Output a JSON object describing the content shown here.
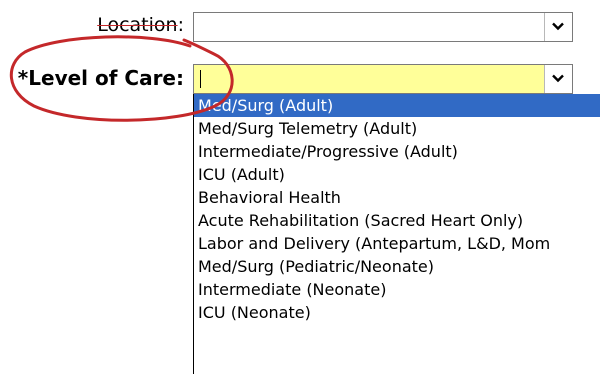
{
  "form": {
    "location_label": "Location",
    "location_colon": ":",
    "location_value": "",
    "level_label": "*Level of Care:",
    "level_value": ""
  },
  "dropdown": {
    "options": [
      "Med/Surg (Adult)",
      "Med/Surg Telemetry (Adult)",
      "Intermediate/Progressive  (Adult)",
      "ICU (Adult)",
      "Behavioral Health",
      "Acute Rehabilitation (Sacred Heart Only)",
      "Labor and Delivery (Antepartum, L&D, Mom",
      "Med/Surg (Pediatric/Neonate)",
      "Intermediate (Neonate)",
      "ICU (Neonate)"
    ],
    "selected_index": 0
  },
  "colors": {
    "annotation": "#c4282a",
    "highlight_field": "#ffff99",
    "selection": "#316ac5"
  },
  "icons": {
    "dropdown_arrow": "chevron-down-icon"
  }
}
